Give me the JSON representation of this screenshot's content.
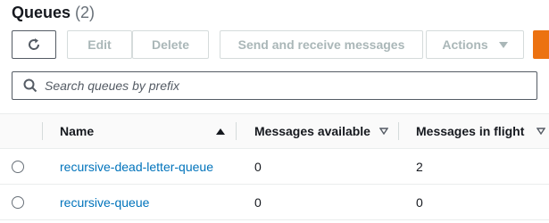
{
  "header": {
    "title": "Queues",
    "count": "(2)"
  },
  "toolbar": {
    "edit_label": "Edit",
    "delete_label": "Delete",
    "send_label": "Send and receive messages",
    "actions_label": "Actions"
  },
  "search": {
    "placeholder": "Search queues by prefix",
    "value": ""
  },
  "table": {
    "columns": [
      "Name",
      "Messages available",
      "Messages in flight"
    ],
    "rows": [
      {
        "name": "recursive-dead-letter-queue",
        "available": "0",
        "in_flight": "2"
      },
      {
        "name": "recursive-queue",
        "available": "0",
        "in_flight": "0"
      }
    ]
  },
  "colors": {
    "link": "#0073bb",
    "primary": "#ec7211",
    "border": "#eaeded"
  },
  "icons": [
    "refresh-icon",
    "chevron-down-icon",
    "search-icon",
    "sort-ascending-icon",
    "sort-icon"
  ]
}
